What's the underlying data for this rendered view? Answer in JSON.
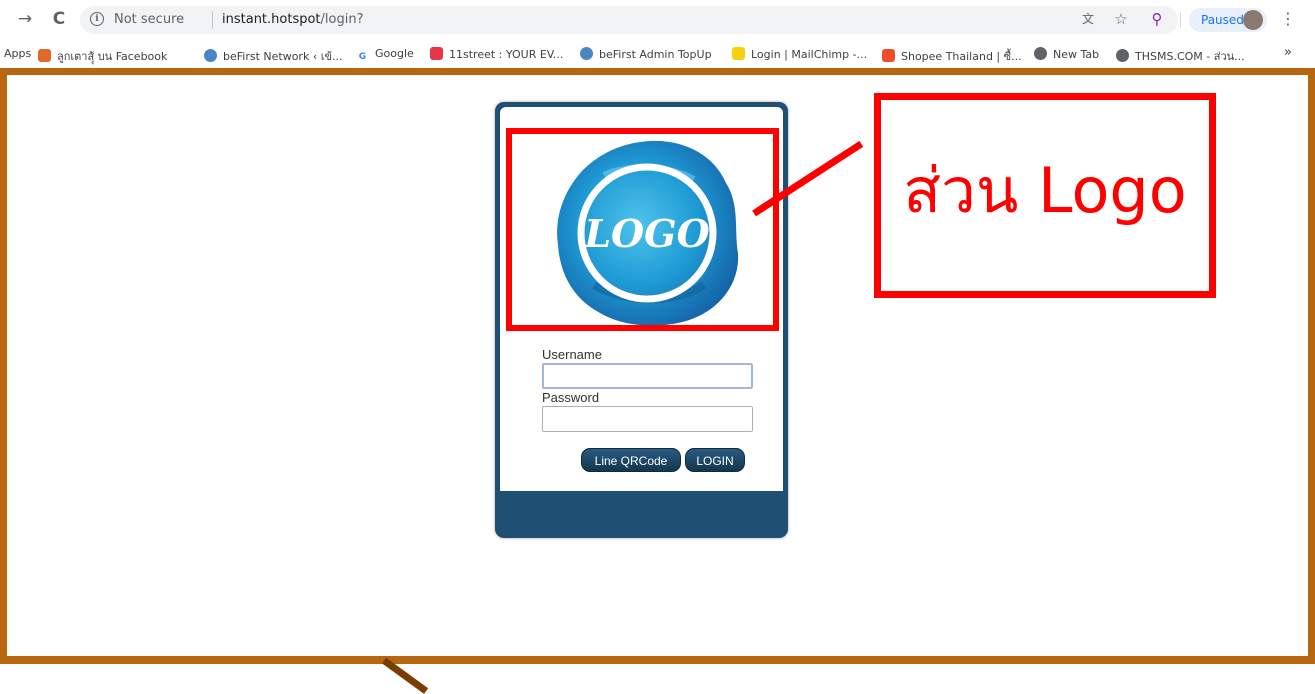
{
  "browser": {
    "back_glyph": "→",
    "reload_glyph": "C",
    "security_label": "Not secure",
    "url_host": "instant.hotspot",
    "url_path": "/login?",
    "paused_label": "Paused",
    "menu_glyph": "⋮",
    "bookmarks": [
      {
        "label": "Apps",
        "icon": "apps-icon"
      },
      {
        "label": "ลูกเตาสฺุ้ บน Facebook",
        "icon": "facebook-icon",
        "color": "#e06a2b"
      },
      {
        "label": "beFirst Network ‹ เข้...",
        "icon": "globe-icon",
        "color": "#4a86c5"
      },
      {
        "label": "Google",
        "icon": "google-icon",
        "color": "#4285f4"
      },
      {
        "label": "11street : YOUR EV...",
        "icon": "11street-icon",
        "color": "#e6374a"
      },
      {
        "label": "beFirst Admin TopUp",
        "icon": "globe-icon",
        "color": "#4a86c5"
      },
      {
        "label": "Login | MailChimp -...",
        "icon": "mailchimp-icon",
        "color": "#f5d10b"
      },
      {
        "label": "Shopee Thailand | ซื้...",
        "icon": "shopee-icon",
        "color": "#ee4d2d"
      },
      {
        "label": "New Tab",
        "icon": "newtab-icon",
        "color": "#5f6368"
      },
      {
        "label": "THSMS.COM - ส่วน...",
        "icon": "newtab-icon",
        "color": "#5f6368"
      }
    ],
    "more_glyph": "»"
  },
  "login": {
    "logo_text": "LOGO",
    "username_label": "Username",
    "username_value": "",
    "password_label": "Password",
    "password_value": "",
    "line_qr_button": "Line QRCode",
    "login_button": "LOGIN"
  },
  "annotation": {
    "callout_text": "ส่วน Logo"
  },
  "colors": {
    "frame": "#b8660f",
    "annotation": "#ff0000",
    "panel": "#1f4f72"
  }
}
